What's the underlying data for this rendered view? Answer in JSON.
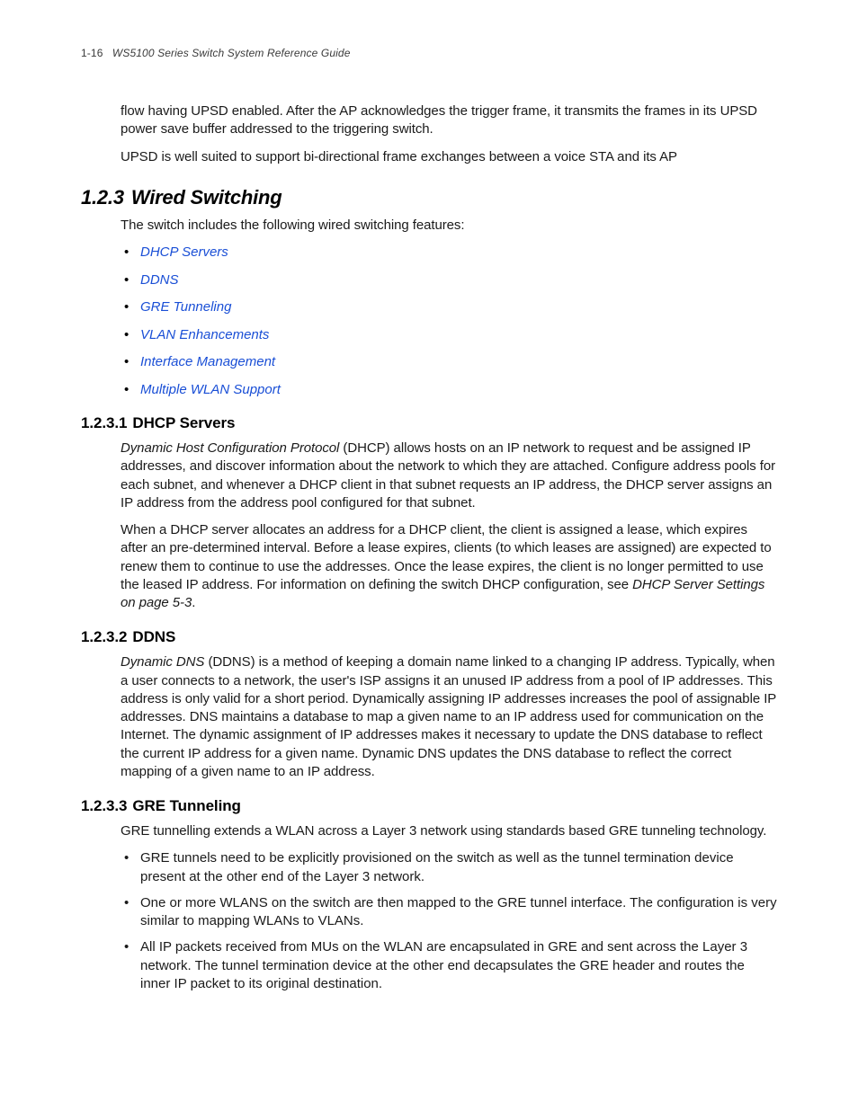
{
  "header": {
    "pagenum": "1-16",
    "title": "WS5100 Series Switch System Reference Guide"
  },
  "intro": {
    "p1": "flow having UPSD enabled. After the AP acknowledges the trigger frame, it transmits the frames in its UPSD power save buffer addressed to the triggering switch.",
    "p2": "UPSD is well suited to support bi-directional frame exchanges between a voice STA and its AP"
  },
  "section": {
    "num": "1.2.3",
    "title": "Wired Switching",
    "lead": "The switch includes the following wired switching features:",
    "links": [
      "DHCP Servers",
      "DDNS",
      "GRE Tunneling",
      "VLAN Enhancements",
      "Interface Management",
      "Multiple WLAN Support"
    ]
  },
  "sub1": {
    "num": "1.2.3.1",
    "title": "DHCP Servers",
    "lead_ital": "Dynamic Host Configuration Protocol",
    "p1_rest": " (DHCP) allows hosts on an IP network to request and be assigned IP addresses, and discover information about the network to which they are attached. Configure address pools for each subnet, and whenever a DHCP client in that subnet requests an IP address, the DHCP server assigns an IP address from the address pool configured for that subnet.",
    "p2_a": "When a DHCP server allocates an address for a DHCP client, the client is assigned a lease, which expires after an pre-determined interval. Before a lease expires, clients (to which leases are assigned) are expected to renew them to continue to use the addresses. Once the lease expires, the client is no longer permitted to use the leased IP address. For information on defining the switch DHCP configuration, see ",
    "p2_ital": "DHCP Server Settings on page 5-3",
    "p2_b": "."
  },
  "sub2": {
    "num": "1.2.3.2",
    "title": "DDNS",
    "lead_ital": "Dynamic DNS",
    "p1_rest": " (DDNS) is a method of keeping a domain name linked to a changing IP address. Typically, when a user connects to a network, the user's ISP assigns it an unused IP address from a pool of IP addresses. This address is only valid for a short period. Dynamically assigning IP addresses increases the pool of assignable IP addresses. DNS maintains a database to map a given name to an IP address used for communication on the Internet. The dynamic assignment of IP addresses makes it necessary to update the DNS database to reflect the current IP address for a given name. Dynamic DNS updates the DNS database to reflect the correct mapping of a given name to an IP address."
  },
  "sub3": {
    "num": "1.2.3.3",
    "title": "GRE Tunneling",
    "p1": "GRE tunnelling extends a WLAN across a Layer 3 network using standards based GRE tunneling technology.",
    "bullets": [
      "GRE tunnels need to be explicitly provisioned on the switch as well as the tunnel termination device present at the other end of the Layer 3 network.",
      "One or more WLANS on the switch are then mapped to the GRE tunnel interface. The configuration is very similar to mapping WLANs to VLANs.",
      "All IP packets received from MUs on the WLAN are encapsulated in GRE and sent across the Layer 3 network. The tunnel termination device at the other end decapsulates the GRE header and routes the inner IP packet to its original destination."
    ]
  }
}
